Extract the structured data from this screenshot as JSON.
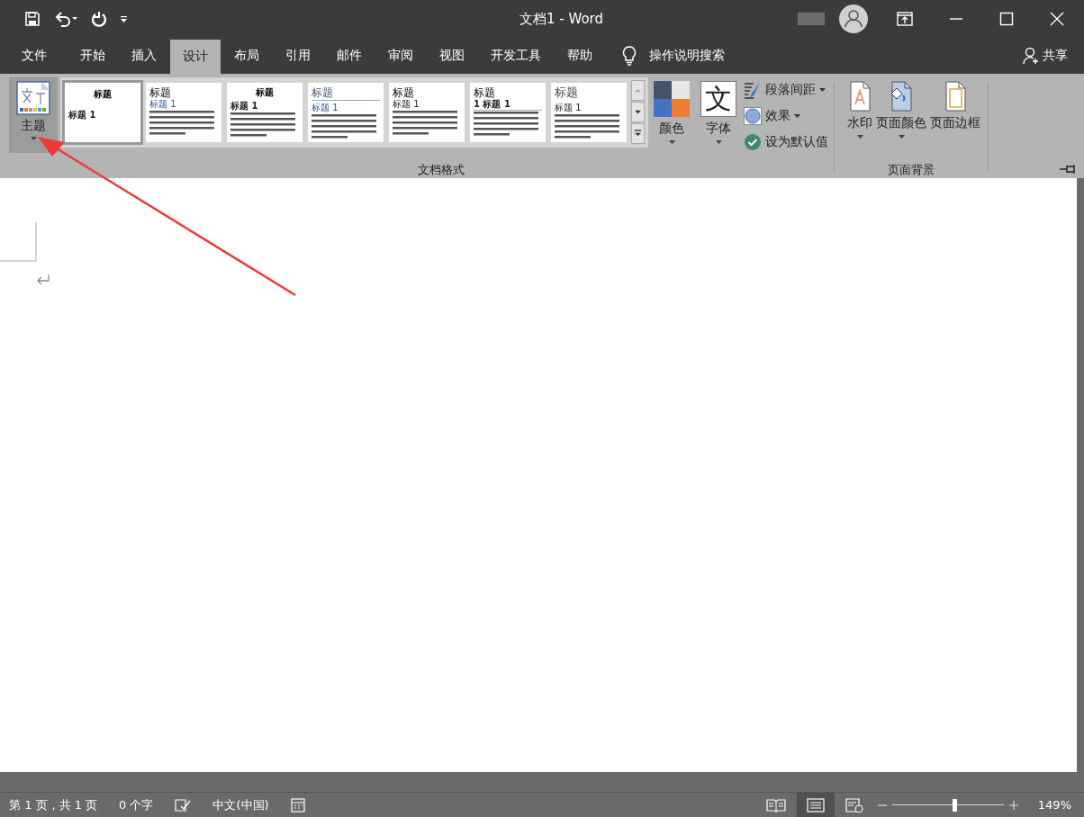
{
  "title_bar": {
    "title": "文档1  -  Word"
  },
  "menu_tabs": [
    {
      "label": "文件",
      "selected": false
    },
    {
      "label": "开始",
      "selected": false
    },
    {
      "label": "插入",
      "selected": false
    },
    {
      "label": "设计",
      "selected": true
    },
    {
      "label": "布局",
      "selected": false
    },
    {
      "label": "引用",
      "selected": false
    },
    {
      "label": "邮件",
      "selected": false
    },
    {
      "label": "审阅",
      "selected": false
    },
    {
      "label": "视图",
      "selected": false
    },
    {
      "label": "开发工具",
      "selected": false
    },
    {
      "label": "帮助",
      "selected": false
    }
  ],
  "tell_me": {
    "placeholder": "操作说明搜索"
  },
  "share": {
    "label": "共享"
  },
  "ribbon": {
    "theme_button": {
      "label": "主题"
    },
    "style_gallery": [
      {
        "kind": "centered",
        "title": "标题",
        "heading": "标题  1",
        "selected": true
      },
      {
        "kind": "plain",
        "title": "标题",
        "heading": "标题 1",
        "selected": false
      },
      {
        "kind": "centered-small",
        "title": "标题",
        "heading": "标题 1",
        "selected": false
      },
      {
        "kind": "lined",
        "title": "标题",
        "heading": "标题 1",
        "selected": false
      },
      {
        "kind": "plain-dark",
        "title": "标题",
        "heading": "标题 1",
        "selected": false
      },
      {
        "kind": "numbered",
        "title": "标题",
        "heading": "1  标题 1",
        "selected": false
      },
      {
        "kind": "plain-large",
        "title": "标题",
        "heading": "标题 1",
        "selected": false
      }
    ],
    "colors": {
      "label": "颜色"
    },
    "fonts": {
      "label": "字体",
      "glyph": "文"
    },
    "small_buttons": [
      {
        "kind": "spacing",
        "label": "段落间距"
      },
      {
        "kind": "effects",
        "label": "效果"
      },
      {
        "kind": "default",
        "label": "设为默认值"
      }
    ],
    "group_document": "文档格式",
    "background_buttons": [
      {
        "kind": "watermark",
        "label": "水印",
        "dropdown": true
      },
      {
        "kind": "page-color",
        "label": "页面颜色",
        "dropdown": true
      },
      {
        "kind": "page-border",
        "label": "页面边框",
        "dropdown": false
      }
    ],
    "group_background": "页面背景"
  },
  "status_bar": {
    "page": "第 1 页，共 1 页",
    "words": "0 个字",
    "language": "中文(中国)",
    "zoom": {
      "level": 0.56,
      "reading": "149%"
    }
  }
}
